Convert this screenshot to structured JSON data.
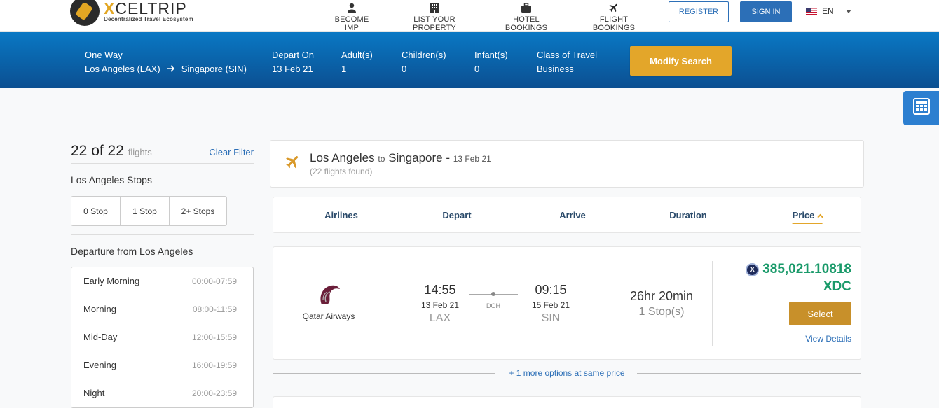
{
  "brand": {
    "name": "XCELTRIP",
    "tagline": "Decentralized Travel Ecosystem"
  },
  "nav": {
    "become_imp": "BECOME IMP",
    "list_property": "LIST YOUR PROPERTY",
    "hotel_bookings": "HOTEL BOOKINGS",
    "flight_bookings": "FLIGHT BOOKINGS",
    "register": "REGISTER",
    "sign_in": "SIGN IN",
    "language": "EN"
  },
  "search": {
    "trip_type": "One Way",
    "origin": "Los Angeles (LAX)",
    "destination": "Singapore (SIN)",
    "depart_label": "Depart On",
    "depart_value": "13 Feb 21",
    "adults_label": "Adult(s)",
    "adults_value": "1",
    "children_label": "Children(s)",
    "children_value": "0",
    "infants_label": "Infant(s)",
    "infants_value": "0",
    "class_label": "Class of Travel",
    "class_value": "Business",
    "modify_label": "Modify Search"
  },
  "filters": {
    "count": "22 of 22",
    "count_unit": "flights",
    "clear_label": "Clear Filter",
    "stops_heading": "Los Angeles Stops",
    "stops": [
      "0 Stop",
      "1 Stop",
      "2+ Stops"
    ],
    "departure_heading": "Departure from Los Angeles",
    "departure_slots": [
      {
        "label": "Early Morning",
        "time": "00:00-07:59"
      },
      {
        "label": "Morning",
        "time": "08:00-11:59"
      },
      {
        "label": "Mid-Day",
        "time": "12:00-15:59"
      },
      {
        "label": "Evening",
        "time": "16:00-19:59"
      },
      {
        "label": "Night",
        "time": "20:00-23:59"
      }
    ]
  },
  "results": {
    "origin_city": "Los Angeles",
    "to_word": "to",
    "destination_city": "Singapore -",
    "date": "13 Feb 21",
    "found": "(22 flights found)"
  },
  "sort": {
    "airlines": "Airlines",
    "depart": "Depart",
    "arrive": "Arrive",
    "duration": "Duration",
    "price": "Price"
  },
  "flight": {
    "airline": "Qatar Airways",
    "dep_time": "14:55",
    "dep_date": "13 Feb 21",
    "dep_code": "LAX",
    "stop_code": "DOH",
    "arr_time": "09:15",
    "arr_date": "15 Feb 21",
    "arr_code": "SIN",
    "duration": "26hr 20min",
    "stops": "1 Stop(s)",
    "price": "385,021.10818",
    "currency": "XDC",
    "coin_letter": "X",
    "select_label": "Select",
    "details_label": "View Details"
  },
  "more_options": "+ 1 more options at same price",
  "colors": {
    "accent": "#e3a62a",
    "brand_blue": "#2c6fb7",
    "price_green": "#1a9a6a"
  },
  "icons": [
    "user-icon",
    "building-icon",
    "suitcase-icon",
    "plane-icon",
    "arrow-right-icon",
    "calculator-icon",
    "chevron-up-icon",
    "chevron-down-icon",
    "flag-us-icon"
  ]
}
